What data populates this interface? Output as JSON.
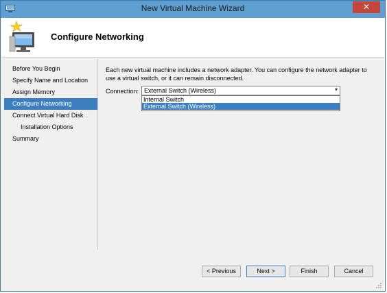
{
  "window": {
    "title": "New Virtual Machine Wizard",
    "close_glyph": "✕"
  },
  "header": {
    "page_title": "Configure Networking"
  },
  "steps": [
    {
      "label": "Before You Begin"
    },
    {
      "label": "Specify Name and Location"
    },
    {
      "label": "Assign Memory"
    },
    {
      "label": "Configure Networking",
      "active": true
    },
    {
      "label": "Connect Virtual Hard Disk"
    },
    {
      "label": "Installation Options",
      "sub": true
    },
    {
      "label": "Summary"
    }
  ],
  "main": {
    "description": "Each new virtual machine includes a network adapter. You can configure the network adapter to use a virtual switch, or it can remain disconnected.",
    "connection_label": "Connection:",
    "connection_value": "External Switch (Wireless)",
    "options": [
      "Internal Switch",
      "External Switch (Wireless)"
    ],
    "selected_option": "External Switch (Wireless)"
  },
  "footer": {
    "previous_label": "< Previous",
    "next_label": "Next >",
    "finish_label": "Finish",
    "cancel_label": "Cancel"
  },
  "colors": {
    "titlebar": "#5e9ed1",
    "selection": "#3c7fc1",
    "close_button": "#c7463c"
  }
}
